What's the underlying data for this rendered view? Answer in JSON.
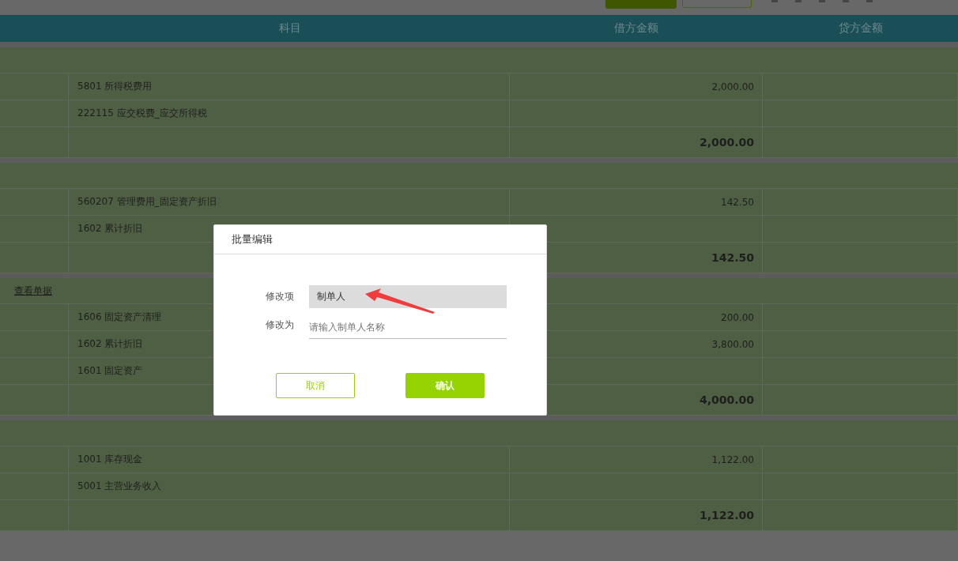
{
  "toolbar": {
    "buttons": [
      {
        "kind": "filled"
      },
      {
        "kind": "outline"
      }
    ]
  },
  "table": {
    "columns": [
      "科目",
      "借方金额",
      "贷方金额"
    ],
    "vouchers": [
      {
        "entries": [
          {
            "account": "5801 所得税费用",
            "debit": "2,000.00"
          },
          {
            "account": "222115 应交税费_应交所得税"
          }
        ],
        "total": "2,000.00"
      },
      {
        "entries": [
          {
            "account": "560207 管理费用_固定资产折旧",
            "debit": "142.50"
          },
          {
            "account": "1602 累计折旧"
          }
        ],
        "total": "142.50"
      },
      {
        "link": "查看单据",
        "entries": [
          {
            "account": "1606 固定资产清理",
            "debit": "200.00"
          },
          {
            "account": "1602 累计折旧",
            "debit": "3,800.00"
          },
          {
            "account": "1601 固定资产"
          }
        ],
        "total": "4,000.00"
      },
      {
        "entries": [
          {
            "account": "1001 库存现金",
            "debit": "1,122.00"
          },
          {
            "account": "5001 主营业务收入"
          }
        ],
        "total": "1,122.00"
      }
    ]
  },
  "dialog": {
    "title": "批量编辑",
    "fields": [
      {
        "label": "修改项",
        "kind": "select",
        "value": "制单人"
      },
      {
        "label": "修改为",
        "kind": "input",
        "placeholder": "请输入制单人名称"
      }
    ],
    "cancel": "取消",
    "confirm": "确认"
  }
}
